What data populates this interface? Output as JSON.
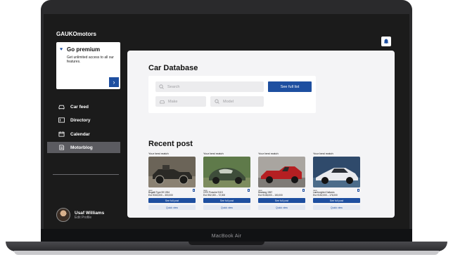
{
  "brand": {
    "logo": "GAUKOmotors"
  },
  "premium": {
    "title": "Go premium",
    "description": "Get unlimited access to all our features."
  },
  "nav": [
    {
      "label": "Car feed",
      "icon": "car-icon"
    },
    {
      "label": "Directory",
      "icon": "id-card-icon"
    },
    {
      "label": "Calendar",
      "icon": "calendar-icon"
    },
    {
      "label": "Motorblog",
      "icon": "document-icon",
      "active": true
    }
  ],
  "user": {
    "name": "Usaf Williams",
    "edit": "Edit Profile"
  },
  "database": {
    "title": "Car Database",
    "search_placeholder": "Search",
    "full_list_label": "See full list",
    "make_placeholder": "Make",
    "model_placeholder": "Model"
  },
  "recent": {
    "title": "Recent post",
    "cards": [
      {
        "match": "Your best match",
        "tag": "new",
        "name": "Bugatti Type 59 1934",
        "price": "Est: €340,000 – 300,000",
        "full_post": "See full post",
        "quick_view": "Quick view"
      },
      {
        "match": "Your best match",
        "tag": "new",
        "name": "1970 Porsche 911S",
        "price": "Est: €52,000 – 72,000",
        "full_post": "See full post",
        "quick_view": "Quick view"
      },
      {
        "match": "Your best match",
        "tag": "new",
        "name": "Mustang 1967",
        "price": "Est: €138,000 – 150,000",
        "full_post": "See full post",
        "quick_view": "Quick view"
      },
      {
        "match": "Your best match",
        "tag": "new",
        "name": "Lamborghini Gallardo",
        "price": "Est: €152,000 – 176,000",
        "full_post": "See full post",
        "quick_view": "Quick view"
      }
    ]
  },
  "device": {
    "label": "MacBook Air"
  },
  "colors": {
    "accent": "#1e4fa0",
    "sidebar": "#1b1b1b",
    "panel": "#f4f4f6"
  }
}
